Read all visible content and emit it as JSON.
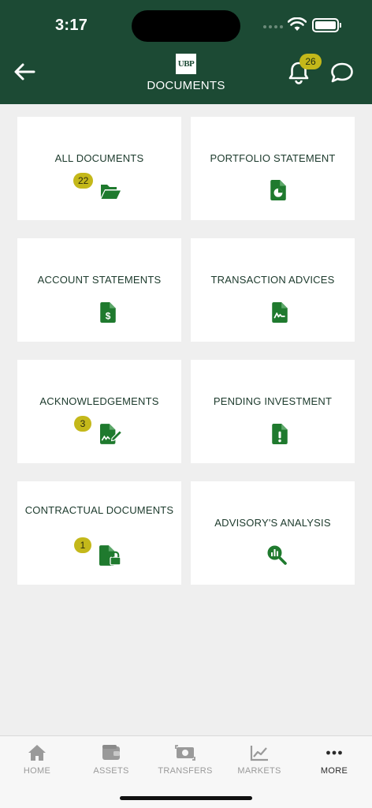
{
  "status_bar": {
    "time": "3:17"
  },
  "header": {
    "logo_text": "UBP",
    "title": "DOCUMENTS",
    "notification_count": "26"
  },
  "tiles": [
    {
      "label": "ALL DOCUMENTS",
      "badge": "22",
      "icon": "folder-open-icon"
    },
    {
      "label": "PORTFOLIO STATEMENT",
      "icon": "file-chart-icon"
    },
    {
      "label": "ACCOUNT STATEMENTS",
      "icon": "file-dollar-icon"
    },
    {
      "label": "TRANSACTION ADVICES",
      "icon": "file-signature-icon"
    },
    {
      "label": "ACKNOWLEDGEMENTS",
      "badge": "3",
      "icon": "file-signed-icon"
    },
    {
      "label": "PENDING INVESTMENT",
      "icon": "file-exclamation-icon"
    },
    {
      "label": "CONTRACTUAL DOCUMENTS",
      "badge": "1",
      "icon": "file-lock-icon"
    },
    {
      "label": "ADVISORY'S ANALYSIS",
      "icon": "search-chart-icon"
    }
  ],
  "tabbar": {
    "items": [
      {
        "label": "HOME",
        "icon": "home-icon"
      },
      {
        "label": "ASSETS",
        "icon": "wallet-icon"
      },
      {
        "label": "TRANSFERS",
        "icon": "transfer-money-icon"
      },
      {
        "label": "MARKETS",
        "icon": "line-chart-icon"
      },
      {
        "label": "MORE",
        "icon": "more-dots-icon",
        "active": true
      }
    ]
  },
  "colors": {
    "header_bg": "#1c4a34",
    "icon_green": "#1f7a2e",
    "badge_yellow": "#c4b81a"
  }
}
